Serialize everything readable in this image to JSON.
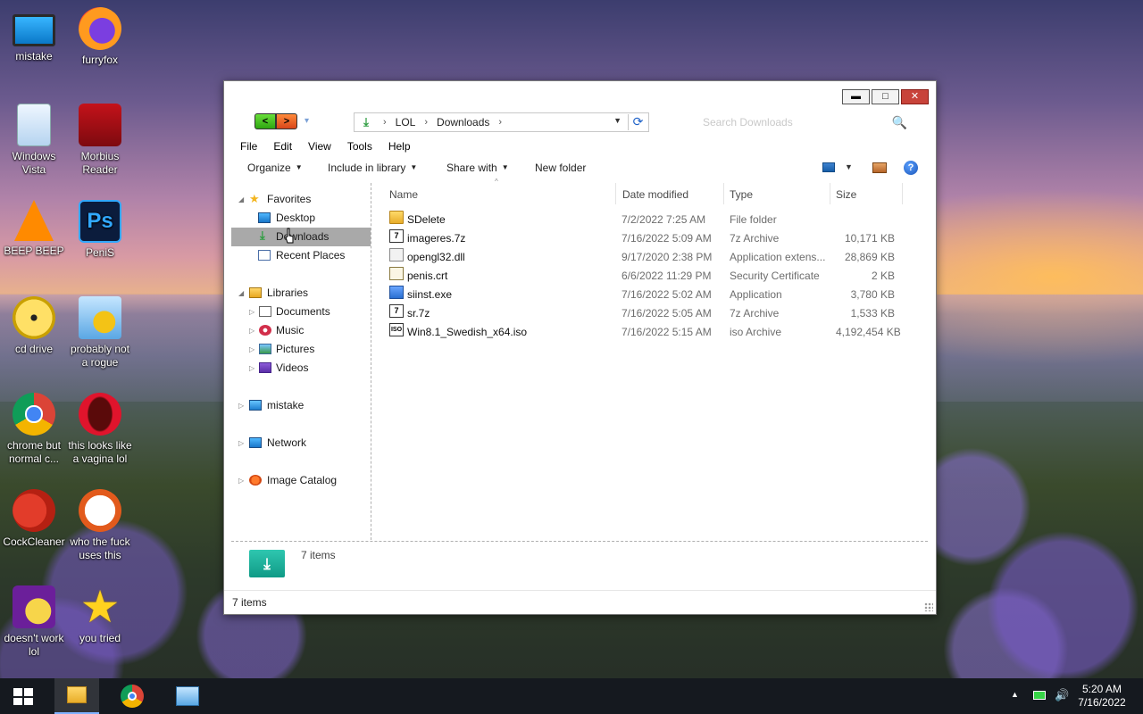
{
  "desktop": {
    "icons": [
      {
        "label": "mistake",
        "icon": "computer-icon"
      },
      {
        "label": "furryfox",
        "icon": "firefox-icon"
      },
      {
        "label": "Windows Vista",
        "icon": "recycle-bin-icon"
      },
      {
        "label": "Morbius Reader",
        "icon": "pdf-reader-icon"
      },
      {
        "label": "BEEP BEEP",
        "icon": "vlc-cone-icon"
      },
      {
        "label": "PeniS",
        "icon": "photoshop-icon"
      },
      {
        "label": "cd drive",
        "icon": "cd-drive-icon"
      },
      {
        "label": "probably not a rogue",
        "icon": "settings-gears-icon"
      },
      {
        "label": "chrome but normal c...",
        "icon": "chrome-icon"
      },
      {
        "label": "this looks like a vagina lol",
        "icon": "opera-icon"
      },
      {
        "label": "CockCleaner",
        "icon": "ccleaner-icon"
      },
      {
        "label": "who the fuck uses this",
        "icon": "flash-icon"
      },
      {
        "label": "doesn't work lol",
        "icon": "yahoo-messenger-icon"
      },
      {
        "label": "you tried",
        "icon": "star-icon"
      }
    ]
  },
  "window": {
    "controls": {
      "minimize": "▬",
      "maximize": "□",
      "close": "✕"
    },
    "nav": {
      "back": "<",
      "forward": ">",
      "recent_caret": "▾"
    },
    "address": {
      "icon_glyph": "⤓",
      "segments": [
        "LOL",
        "Downloads"
      ],
      "separator": "›",
      "dropdown": "▼",
      "refresh": "⟳"
    },
    "search": {
      "placeholder": "Search Downloads",
      "icon_glyph": "🔍"
    },
    "menu": [
      "File",
      "Edit",
      "View",
      "Tools",
      "Help"
    ],
    "toolbar": {
      "organize": "Organize",
      "include_in_library": "Include in library",
      "share_with": "Share with",
      "new_folder": "New folder",
      "dropdown_caret": "▼",
      "help_glyph": "?"
    },
    "nav_pane": {
      "favorites": {
        "label": "Favorites",
        "items": [
          "Desktop",
          "Downloads",
          "Recent Places"
        ]
      },
      "libraries": {
        "label": "Libraries",
        "items": [
          "Documents",
          "Music",
          "Pictures",
          "Videos"
        ]
      },
      "computer": "mistake",
      "network": "Network",
      "image_catalog": "Image Catalog",
      "selected": "Downloads"
    },
    "columns": {
      "name": "Name",
      "date": "Date modified",
      "type": "Type",
      "size": "Size",
      "sort_caret": "^"
    },
    "files": [
      {
        "name": "SDelete",
        "date": "7/2/2022 7:25 AM",
        "type": "File folder",
        "size": "",
        "icon": "folder-icon"
      },
      {
        "name": "imageres.7z",
        "date": "7/16/2022 5:09 AM",
        "type": "7z Archive",
        "size": "10,171 KB",
        "icon": "archive-7z-icon"
      },
      {
        "name": "opengl32.dll",
        "date": "9/17/2020 2:38 PM",
        "type": "Application extens...",
        "size": "28,869 KB",
        "icon": "dll-file-icon"
      },
      {
        "name": "penis.crt",
        "date": "6/6/2022 11:29 PM",
        "type": "Security Certificate",
        "size": "2 KB",
        "icon": "certificate-icon"
      },
      {
        "name": "siinst.exe",
        "date": "7/16/2022 5:02 AM",
        "type": "Application",
        "size": "3,780 KB",
        "icon": "exe-file-icon"
      },
      {
        "name": "sr.7z",
        "date": "7/16/2022 5:05 AM",
        "type": "7z Archive",
        "size": "1,533 KB",
        "icon": "archive-7z-icon"
      },
      {
        "name": "Win8.1_Swedish_x64.iso",
        "date": "7/16/2022 5:15 AM",
        "type": "iso Archive",
        "size": "4,192,454 KB",
        "icon": "iso-file-icon"
      }
    ],
    "details": {
      "count_text": "7 items",
      "icon_glyph": "⤓"
    },
    "status": "7 items"
  },
  "taskbar": {
    "tray_caret": "▲",
    "volume_glyph": "🔊",
    "time": "5:20 AM",
    "date": "7/16/2022"
  }
}
